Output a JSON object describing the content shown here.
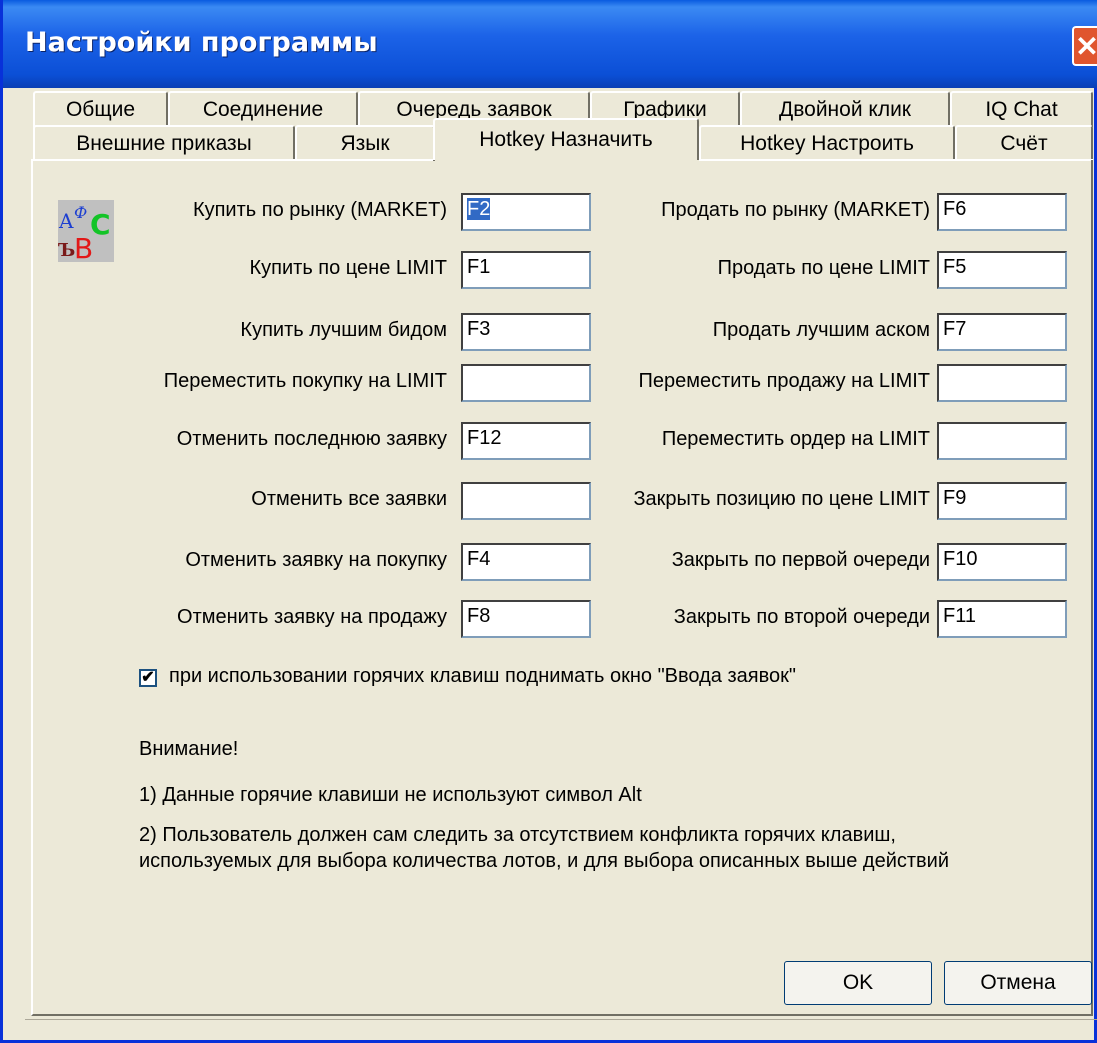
{
  "window": {
    "title": "Настройки программы",
    "close_glyph": "✕"
  },
  "tabs_row1": [
    "Общие",
    "Соединение",
    "Очередь заявок",
    "Графики",
    "Двойной клик",
    "IQ Chat"
  ],
  "tabs_row2": [
    "Внешние приказы",
    "Язык",
    "Hotkey Назначить",
    "Hotkey Настроить",
    "Счёт"
  ],
  "active_tab": "Hotkey Назначить",
  "left_fields": [
    {
      "label": "Купить по рынку (MARKET)",
      "value": "F2"
    },
    {
      "label": "Купить по цене LIMIT",
      "value": "F1"
    },
    {
      "label": "Купить лучшим бидом",
      "value": "F3"
    },
    {
      "label": "Переместить покупку на LIMIT",
      "value": ""
    },
    {
      "label": "Отменить последнюю заявку",
      "value": "F12"
    },
    {
      "label": "Отменить все заявки",
      "value": ""
    },
    {
      "label": "Отменить заявку на покупку",
      "value": "F4"
    },
    {
      "label": "Отменить заявку на продажу",
      "value": "F8"
    }
  ],
  "right_fields": [
    {
      "label": "Продать по рынку (MARKET)",
      "value": "F6"
    },
    {
      "label": "Продать по цене LIMIT",
      "value": "F5"
    },
    {
      "label": "Продать лучшим аском",
      "value": "F7"
    },
    {
      "label": "Переместить продажу на LIMIT",
      "value": ""
    },
    {
      "label": "Переместить ордер на LIMIT",
      "value": ""
    },
    {
      "label": "Закрыть позицию по цене LIMIT",
      "value": "F9"
    },
    {
      "label": "Закрыть по первой очереди",
      "value": "F10"
    },
    {
      "label": "Закрыть по второй очереди",
      "value": "F11"
    }
  ],
  "checkbox": {
    "checked": true,
    "glyph": "✔",
    "label": "при использовании горячих клавиш поднимать окно \"Ввода заявок\""
  },
  "notes": {
    "heading": "Внимание!",
    "line1": "1) Данные горячие клавиши не используют символ Alt",
    "line2a": "2) Пользователь должен сам следить за отсутствием конфликта горячих клавиш,",
    "line2b": "используемых для выбора количества лотов, и для выбора описанных выше действий"
  },
  "buttons": {
    "ok": "OK",
    "cancel": "Отмена"
  },
  "logo_icon": "abc-language-icon"
}
